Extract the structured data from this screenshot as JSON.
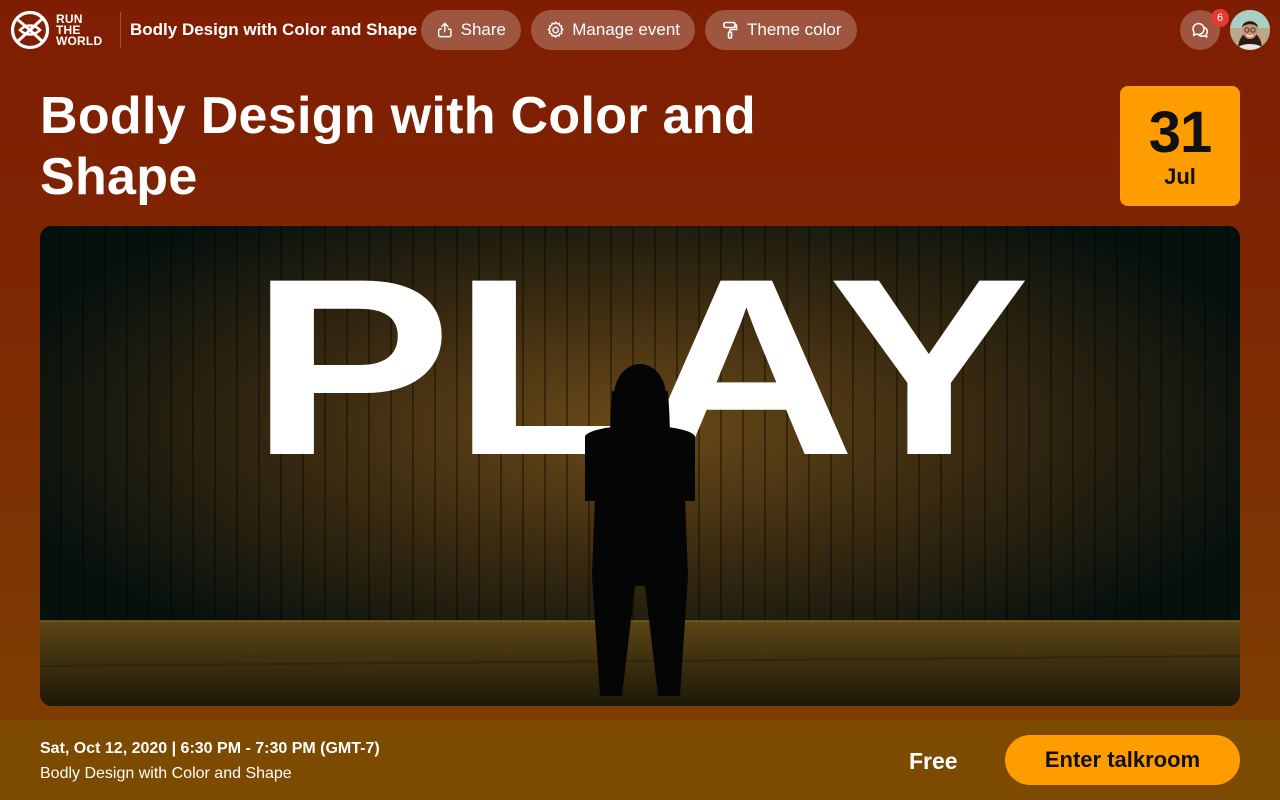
{
  "app": {
    "logo_text": [
      "RUN",
      "THE",
      "WORLD"
    ],
    "event_title": "Bodly Design with Color and Shape"
  },
  "toolbar": {
    "share_label": "Share",
    "manage_label": "Manage event",
    "theme_label": "Theme color",
    "chat_badge_count": "6"
  },
  "hero": {
    "title": "Bodly Design with Color and Shape",
    "date_day": "31",
    "date_month": "Jul",
    "banner_text": "PLAY"
  },
  "footer": {
    "datetime": "Sat, Oct 12, 2020 | 6:30 PM - 7:30 PM (GMT-7)",
    "event_name": "Bodly Design with Color and Shape",
    "price": "Free",
    "enter_label": "Enter talkroom"
  },
  "icons": {
    "share": "share-icon",
    "manage": "gear-icon",
    "theme": "paint-roller-icon",
    "chat": "chat-bubbles-icon"
  },
  "colors": {
    "accent": "#ff9d00",
    "background_top": "#7f1d02",
    "background_bottom": "#7e4302",
    "badge": "#e53935"
  }
}
